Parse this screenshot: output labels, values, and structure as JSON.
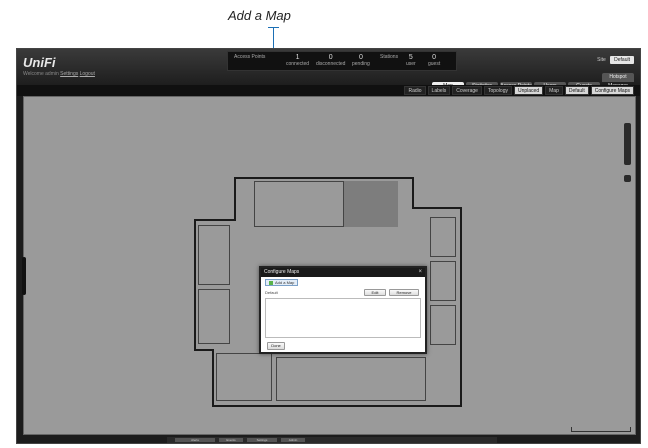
{
  "annotation": {
    "callout_text": "Add a Map",
    "line_color": "#1b6fb5"
  },
  "app": {
    "logo": "UniFi",
    "sitebar_text": "Welcome admin",
    "sitebar_links": [
      "Settings",
      "Logout"
    ]
  },
  "stats": {
    "access_points_label": "Access Points",
    "ap_value": "1",
    "ap_caption": "connected",
    "disconnected_value": "0",
    "disconnected_caption": "disconnected",
    "pending_value": "0",
    "pending_caption": "pending",
    "stations_label": "Stations",
    "user_value": "5",
    "user_caption": "user",
    "guest_value": "0",
    "guest_caption": "guest"
  },
  "site_selector": {
    "label": "Site",
    "value": "Default"
  },
  "tabs": [
    {
      "label": "Map",
      "active": true
    },
    {
      "label": "Statistics",
      "active": false
    },
    {
      "label": "Access Points",
      "active": false
    },
    {
      "label": "Users",
      "active": false
    },
    {
      "label": "Guests",
      "active": false
    },
    {
      "label": "Hotspot Manager",
      "active": false
    }
  ],
  "toolbar": {
    "items": [
      "Radio",
      "Labels",
      "Coverage",
      "Topology",
      "Unplaced",
      "Map"
    ],
    "map_select": "Default",
    "configure_button": "Configure Maps"
  },
  "dialog": {
    "title": "Configure Maps",
    "add_label": "Add a Map",
    "section_label": "Default",
    "edit_button": "Edit",
    "remove_button": "Remove",
    "done_button": "Done"
  },
  "bottombar": {
    "items": [
      "Alerts",
      "Events",
      "Settings",
      "Admin"
    ]
  },
  "colors": {
    "map_bg": "#9a9a9a",
    "chrome": "#1c1c1c",
    "active_tab": "#efefef",
    "add_highlight": "#5ab34a"
  }
}
